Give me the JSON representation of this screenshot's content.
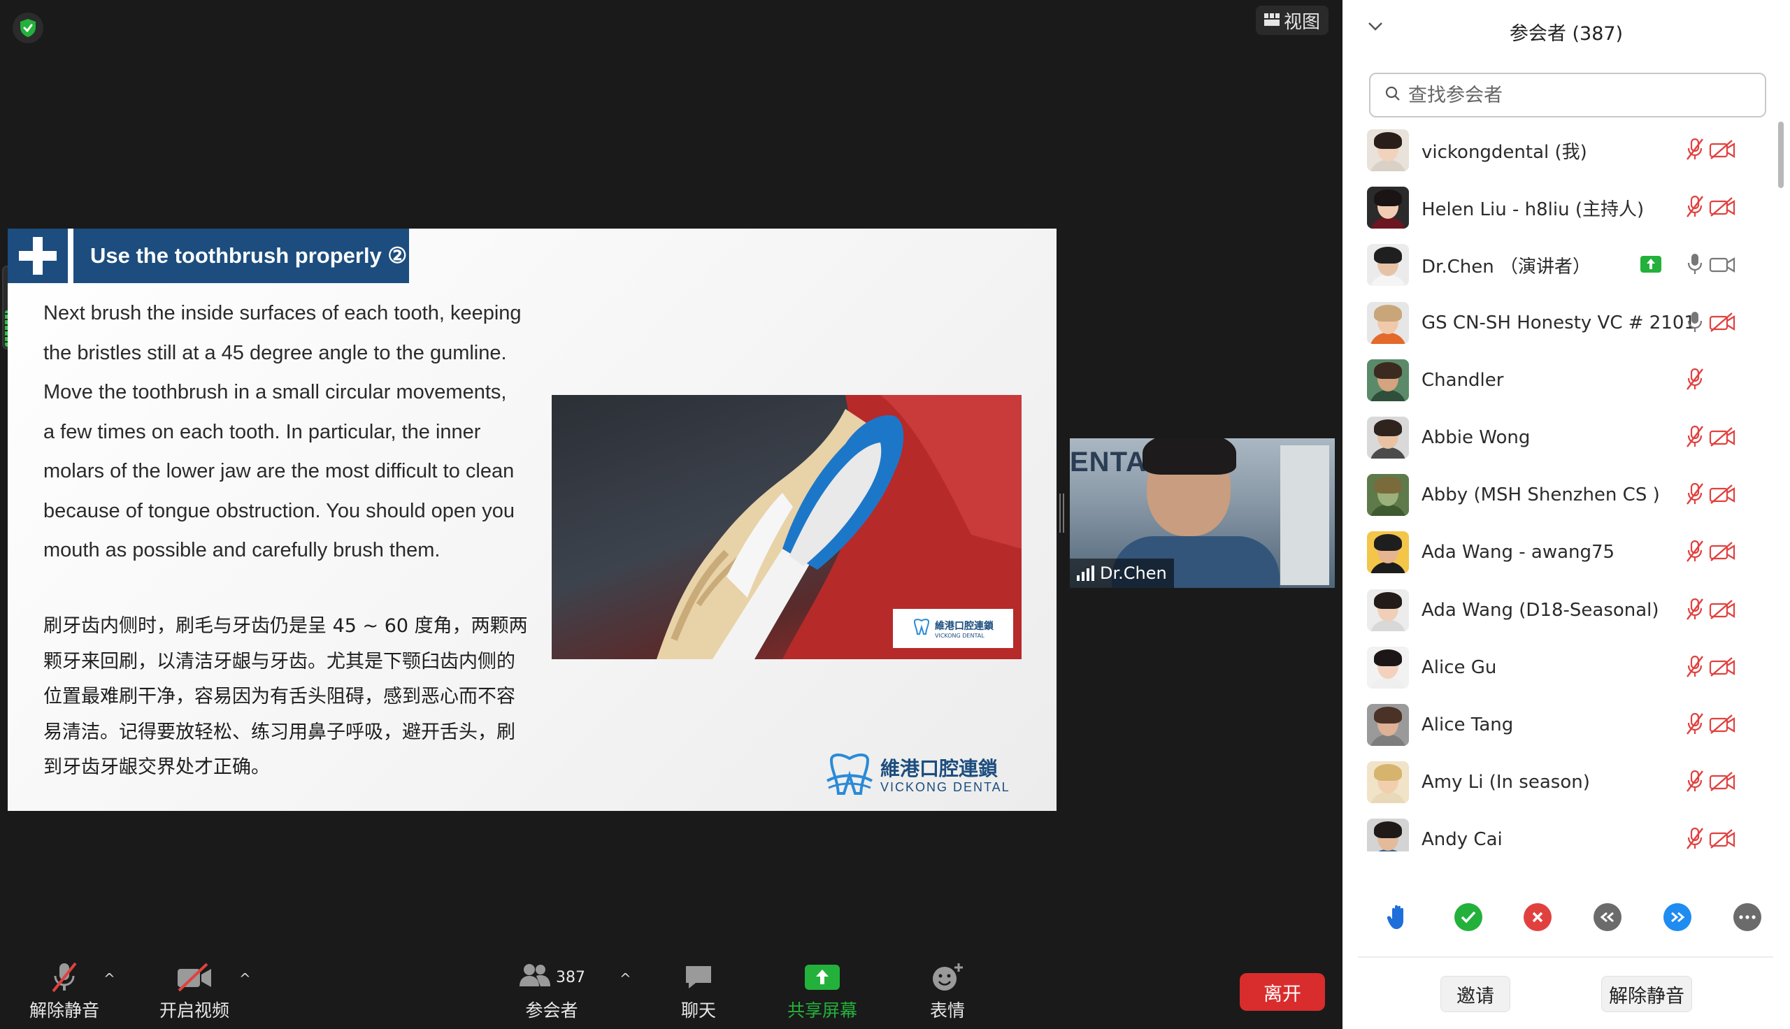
{
  "top": {
    "view_label": "视图"
  },
  "slide": {
    "title": "Use the toothbrush properly ②",
    "body_en": [
      "Next brush the inside surfaces of each tooth, keeping",
      "the bristles still at a 45 degree angle to the gumline.",
      "Move the toothbrush in a small circular movements,",
      "a few times on each tooth. In particular, the inner",
      "molars of the lower jaw are the most difficult to clean",
      "because of tongue obstruction. You should open you",
      "mouth as possible and carefully brush them."
    ],
    "body_zh": [
      "刷牙齿内侧时，刷毛与牙齿仍是呈 45 ~ 60 度角，两颗两",
      "颗牙来回刷，以清洁牙龈与牙齿。尤其是下颚臼齿内侧的",
      "位置最难刷干净，容易因为有舌头阻碍，感到恶心而不容",
      "易清洁。记得要放轻松、练习用鼻子呼吸，避开舌头，刷",
      "到牙齿牙龈交界处才正确。"
    ],
    "photo_logo_cn": "維港口腔連鎖",
    "photo_logo_en": "VICKONG DENTAL",
    "brand_cn": "維港口腔連鎖",
    "brand_en": "VICKONG DENTAL"
  },
  "speaker": {
    "name": "Dr.Chen",
    "background_text": "ENTA"
  },
  "toolbar": {
    "unmute": "解除静音",
    "start_video": "开启视频",
    "participants_count": "387",
    "participants": "参会者",
    "chat": "聊天",
    "share_screen": "共享屏幕",
    "reactions": "表情",
    "leave": "离开"
  },
  "panel": {
    "title": "参会者 (387)",
    "search_placeholder": "查找参会者",
    "participants": [
      {
        "name": "vickongdental (我)",
        "mic": "muted",
        "video": "off",
        "share": false,
        "avatar": [
          "#e9e2da",
          "#2a1e1a",
          "#f1d2bd",
          "#d9d0c6"
        ]
      },
      {
        "name": "Helen Liu - h8liu (主持人)",
        "mic": "muted",
        "video": "off",
        "share": false,
        "avatar": [
          "#2b2b2b",
          "#1b1414",
          "#f2cdb4",
          "#6b1620"
        ]
      },
      {
        "name": "Dr.Chen （演讲者）",
        "mic": "on",
        "video": "on",
        "share": true,
        "avatar": [
          "#ebebeb",
          "#1f1f1f",
          "#e7c3a5",
          "#f5f5f5"
        ]
      },
      {
        "name": "GS CN-SH Honesty VC # 2101",
        "mic": "on",
        "video": "off",
        "share": false,
        "avatar": [
          "#e6e6e6",
          "#c9a67a",
          "#f0c9ab",
          "#e36a2a"
        ]
      },
      {
        "name": "Chandler",
        "mic": "muted",
        "video": "none",
        "share": false,
        "avatar": [
          "#5b8a6a",
          "#3b2a20",
          "#d3a47f",
          "#2f4f3a"
        ]
      },
      {
        "name": "Abbie Wong",
        "mic": "muted",
        "video": "off",
        "share": false,
        "avatar": [
          "#d9d9d9",
          "#2e231d",
          "#e8c2a2",
          "#4b4b4b"
        ]
      },
      {
        "name": "Abby (MSH Shenzhen CS )",
        "mic": "muted",
        "video": "off",
        "share": false,
        "avatar": [
          "#5e7a4a",
          "#7b6a3c",
          "#9bb07a",
          "#3e5b30"
        ]
      },
      {
        "name": "Ada Wang - awang75",
        "mic": "muted",
        "video": "off",
        "share": false,
        "avatar": [
          "#f3c64a",
          "#1e1e1e",
          "#e6b48e",
          "#1c1c1c"
        ]
      },
      {
        "name": "Ada Wang (D18-Seasonal)",
        "mic": "muted",
        "video": "off",
        "share": false,
        "avatar": [
          "#ececec",
          "#231b18",
          "#f0cfb8",
          "#d8d8d8"
        ]
      },
      {
        "name": "Alice Gu",
        "mic": "muted",
        "video": "off",
        "share": false,
        "avatar": [
          "#f2f2f2",
          "#1c1616",
          "#f3d1bc",
          "#efefef"
        ]
      },
      {
        "name": "Alice Tang",
        "mic": "muted",
        "video": "off",
        "share": false,
        "avatar": [
          "#9a9a9a",
          "#4a3326",
          "#dfb196",
          "#7d7d7d"
        ]
      },
      {
        "name": "Amy Li (In season)",
        "mic": "muted",
        "video": "off",
        "share": false,
        "avatar": [
          "#f0e3c8",
          "#d6b46e",
          "#f1cfae",
          "#e9d9b9"
        ]
      },
      {
        "name": "Andy Cai",
        "mic": "muted",
        "video": "off",
        "share": false,
        "avatar": [
          "#d4d4d4",
          "#1f1a17",
          "#e3bb9b",
          "#3a5f8a"
        ]
      }
    ],
    "invite": "邀请",
    "unmute_me": "解除静音"
  },
  "colors": {
    "accent_blue": "#1c4d7e",
    "leave_red": "#d92c2c",
    "share_green": "#23b13b",
    "muted_red": "#e0413f"
  },
  "meters": {
    "audio_level": 0.45
  }
}
